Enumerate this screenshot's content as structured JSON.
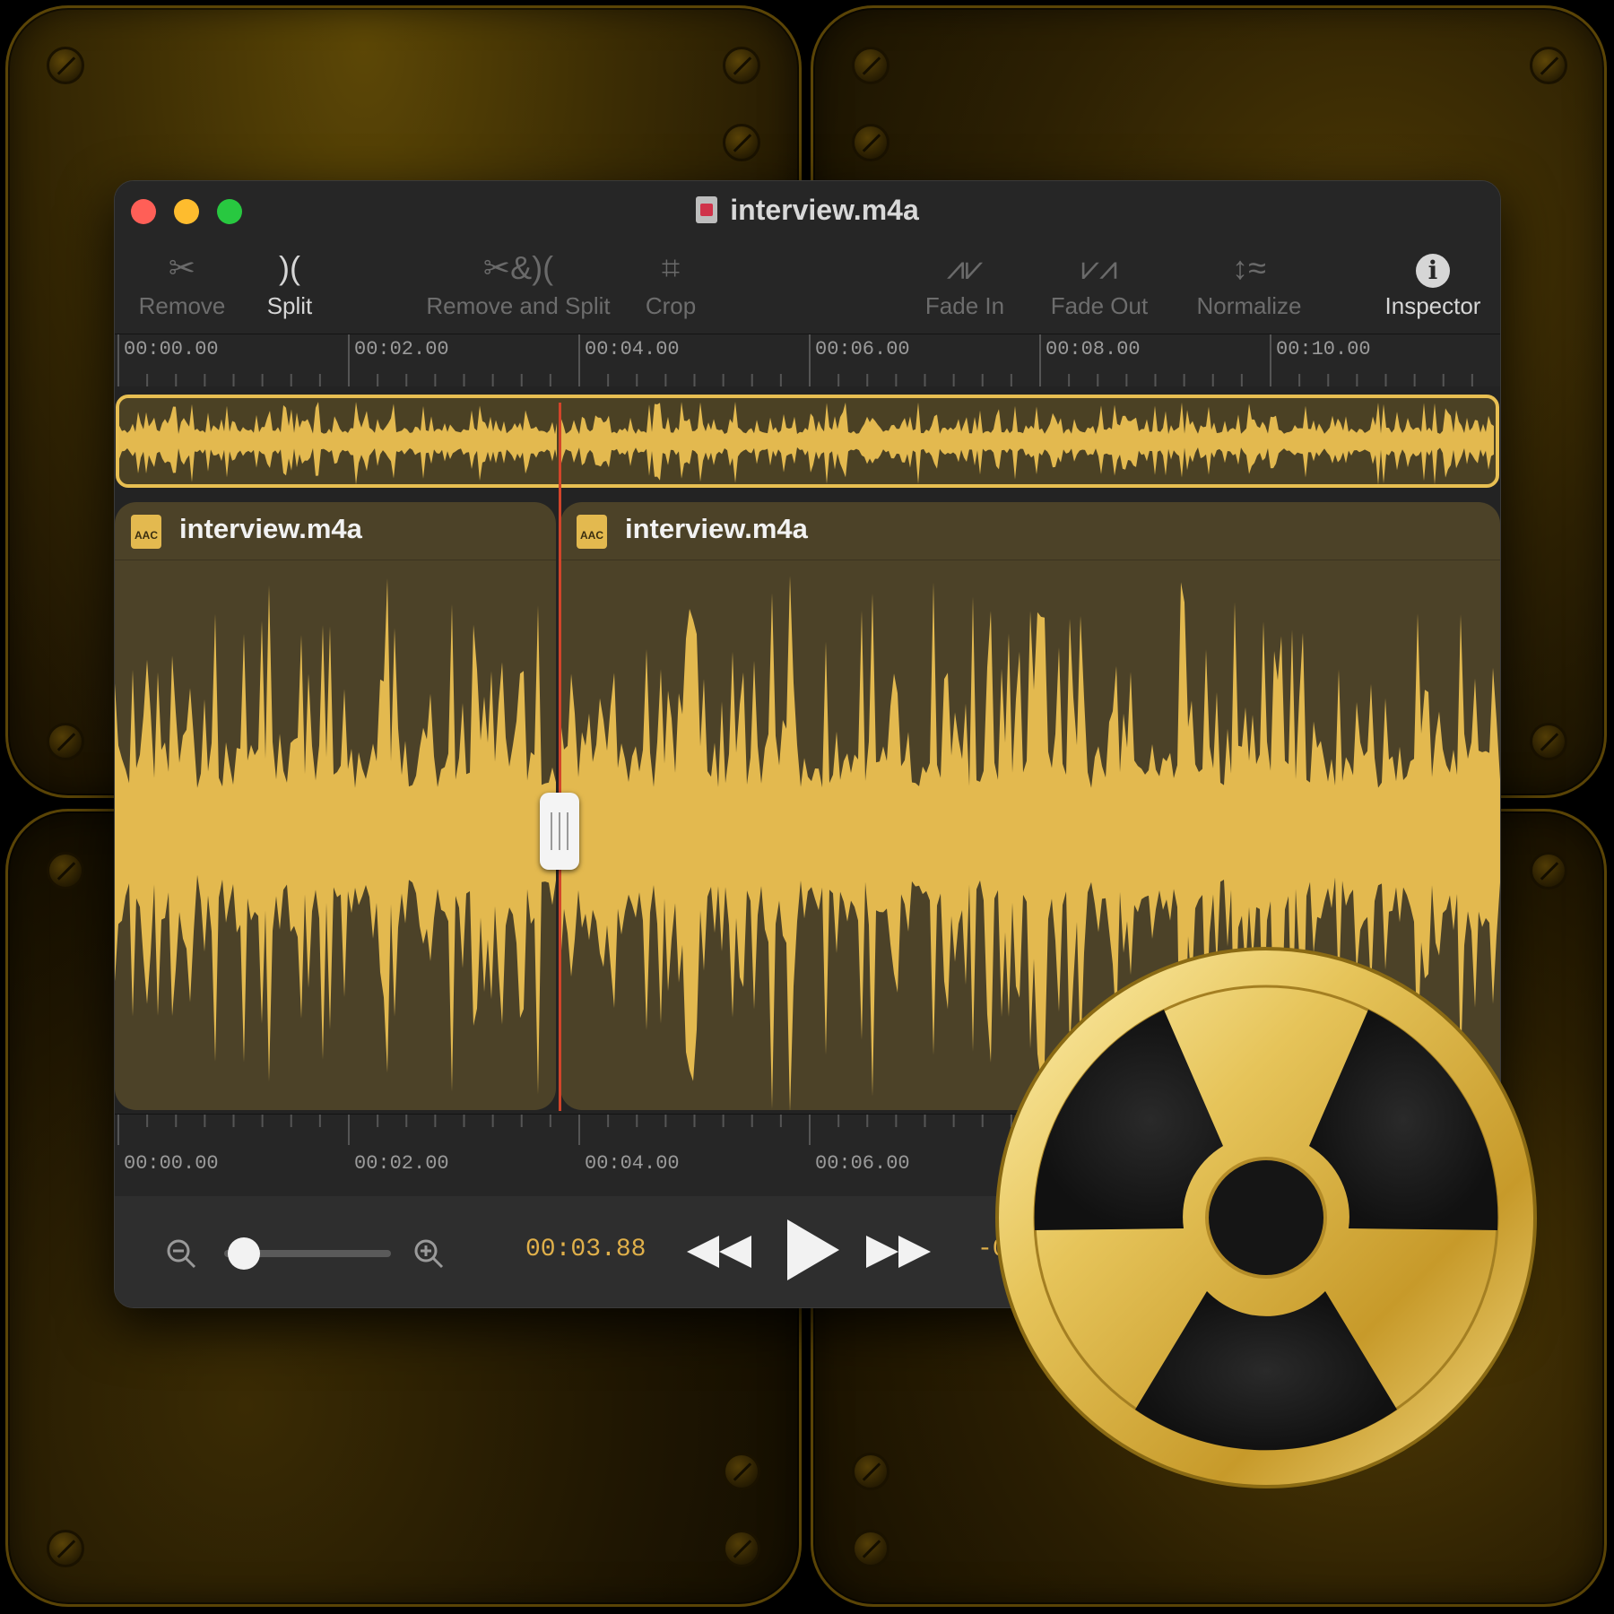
{
  "window": {
    "title": "interview.m4a"
  },
  "toolbar": {
    "items": [
      {
        "label": "Remove",
        "icon": "scissors-icon",
        "enabled": false
      },
      {
        "label": "Split",
        "icon": "split-icon",
        "enabled": true
      },
      {
        "label": "Remove and Split",
        "icon": "remove-split-icon",
        "enabled": false
      },
      {
        "label": "Crop",
        "icon": "crop-icon",
        "enabled": false
      },
      {
        "label": "Fade In",
        "icon": "fade-in-icon",
        "enabled": false
      },
      {
        "label": "Fade Out",
        "icon": "fade-out-icon",
        "enabled": false
      },
      {
        "label": "Normalize",
        "icon": "normalize-icon",
        "enabled": false
      },
      {
        "label": "Inspector",
        "icon": "info-icon",
        "enabled": true
      }
    ]
  },
  "ruler_top": {
    "labels": [
      "00:00.00",
      "00:02.00",
      "00:04.00",
      "00:06.00",
      "00:08.00",
      "00:10.00"
    ]
  },
  "ruler_bottom": {
    "labels": [
      "00:00.00",
      "00:02.00",
      "00:04.00",
      "00:06.00"
    ]
  },
  "clips": [
    {
      "name": "interview.m4a",
      "format": "AAC"
    },
    {
      "name": "interview.m4a",
      "format": "AAC"
    }
  ],
  "transport": {
    "current_time": "00:03.88",
    "trailing_text": "-0",
    "zoom_level": 0.05
  },
  "colors": {
    "accent": "#e8bf52",
    "waveform": "#e3b94f",
    "clip_bg": "#4c4228",
    "playhead": "#d2442a"
  }
}
